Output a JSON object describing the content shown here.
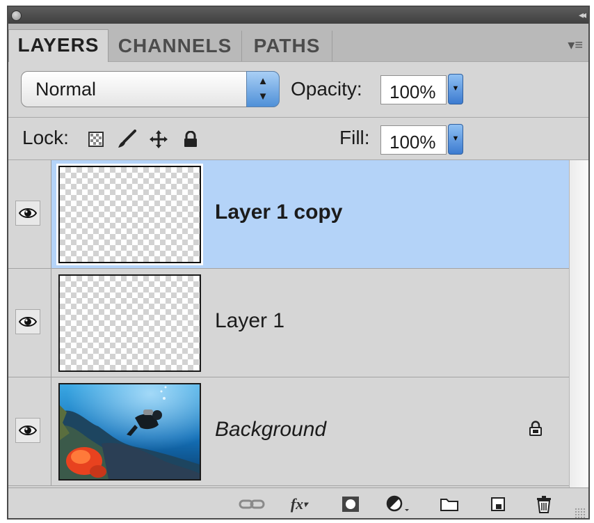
{
  "tabs": [
    {
      "label": "LAYERS",
      "active": true
    },
    {
      "label": "CHANNELS",
      "active": false
    },
    {
      "label": "PATHS",
      "active": false
    }
  ],
  "blend_mode": {
    "value": "Normal"
  },
  "opacity": {
    "label": "Opacity:",
    "value": "100%"
  },
  "lock": {
    "label": "Lock:",
    "icons": [
      "lock-transparent-pixels-icon",
      "lock-image-pixels-icon",
      "lock-position-icon",
      "lock-all-icon"
    ]
  },
  "fill": {
    "label": "Fill:",
    "value": "100%"
  },
  "layers": [
    {
      "name": "Layer 1 copy",
      "visible": true,
      "selected": true,
      "thumbnail": "transparent",
      "locked": false
    },
    {
      "name": "Layer 1",
      "visible": true,
      "selected": false,
      "thumbnail": "transparent",
      "locked": false
    },
    {
      "name": "Background",
      "visible": true,
      "selected": false,
      "thumbnail": "underwater-photo",
      "locked": true
    }
  ],
  "bottom_bar": [
    "link-layers-icon",
    "layer-style-icon",
    "layer-mask-icon",
    "adjustment-layer-icon",
    "new-group-icon",
    "new-layer-icon",
    "delete-layer-icon"
  ],
  "colors": {
    "selection": "#b4d3f8",
    "accent_blue": "#4f90d8",
    "panel_bg": "#d6d6d6"
  }
}
